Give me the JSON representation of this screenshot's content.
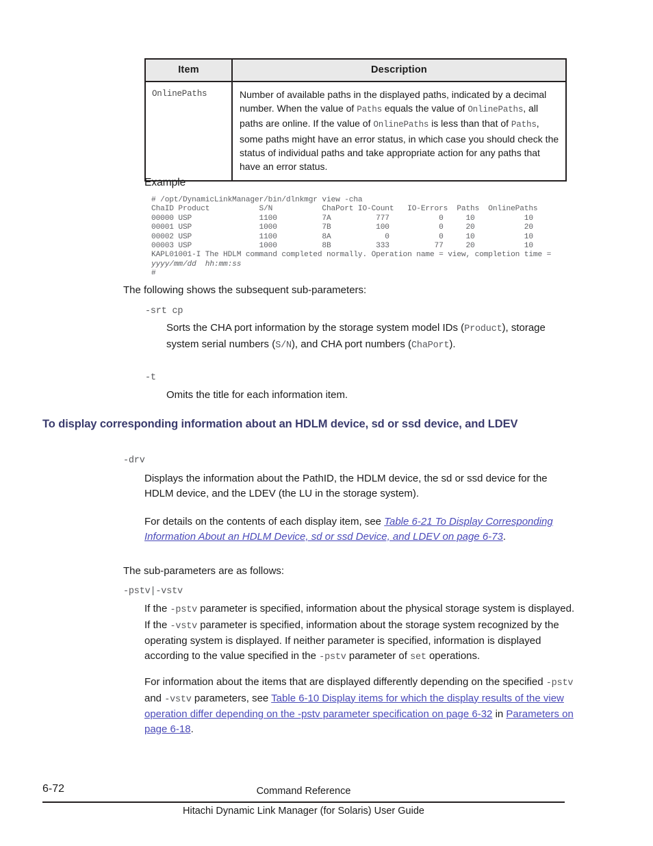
{
  "table": {
    "headers": [
      "Item",
      "Description"
    ],
    "rows": [
      {
        "item": "OnlinePaths",
        "description_segments": [
          {
            "t": "Number of available paths in the displayed paths, indicated by a decimal number. When the value of ",
            "k": "text"
          },
          {
            "t": "Paths",
            "k": "code"
          },
          {
            "t": " equals the value of ",
            "k": "text"
          },
          {
            "t": "OnlinePaths",
            "k": "code"
          },
          {
            "t": ", all paths are online. If the value of ",
            "k": "text"
          },
          {
            "t": "OnlinePaths",
            "k": "code"
          },
          {
            "t": " is less than that of ",
            "k": "text"
          },
          {
            "t": "Paths",
            "k": "code"
          },
          {
            "t": ", some paths might have an error status, in which case you should check the status of individual paths and take appropriate action for any paths that have an error status.",
            "k": "text"
          }
        ]
      }
    ]
  },
  "example": {
    "label": "Example",
    "lines": [
      "# /opt/DynamicLinkManager/bin/dlnkmgr view -cha",
      "ChaID Product           S/N           ChaPort IO-Count   IO-Errors  Paths  OnlinePaths",
      "00000 USP               1100          7A          777           0     10           10",
      "00001 USP               1000          7B          100           0     20           20",
      "00002 USP               1100          8A            0           0     10           10",
      "00003 USP               1000          8B          333          77     20           10",
      "KAPL01001-I The HDLM command completed normally. Operation name = view, completion time ="
    ],
    "italic_line": "yyyy/mm/dd  hh:mm:ss",
    "prompt_line": "#"
  },
  "body": {
    "following_intro": "The following shows the subsequent sub-parameters:",
    "srt_term": "-srt cp",
    "srt_desc_segments": [
      {
        "t": "Sorts the CHA port information by the storage system model IDs (",
        "k": "text"
      },
      {
        "t": "Product",
        "k": "code"
      },
      {
        "t": "), storage system serial numbers (",
        "k": "text"
      },
      {
        "t": "S/N",
        "k": "code"
      },
      {
        "t": "), and CHA port numbers (",
        "k": "text"
      },
      {
        "t": "ChaPort",
        "k": "code"
      },
      {
        "t": ").",
        "k": "text"
      }
    ],
    "t_term": "-t",
    "t_desc": "Omits the title for each information item.",
    "section_heading": "To display corresponding information about an HDLM device, sd or ssd device, and LDEV",
    "drv_term": "-drv",
    "drv_desc": "Displays the information about the PathID, the HDLM device, the sd or ssd device for the HDLM device, and the LDEV (the LU in the storage system).",
    "drv_desc2_segments": [
      {
        "t": "For details on the contents of each display item, see ",
        "k": "text"
      },
      {
        "t": "Table 6-21 To Display Corresponding Information About an HDLM Device, sd or ssd Device, and LDEV on page 6-73",
        "k": "link-italic"
      },
      {
        "t": ".",
        "k": "text"
      }
    ],
    "subparams_intro": "The sub-parameters are as follows:",
    "pstv_term": "-pstv|-vstv",
    "pstv_desc_segments": [
      {
        "t": "If the ",
        "k": "text"
      },
      {
        "t": "-pstv",
        "k": "code"
      },
      {
        "t": " parameter is specified, information about the physical storage system is displayed. If the ",
        "k": "text"
      },
      {
        "t": "-vstv",
        "k": "code"
      },
      {
        "t": " parameter is specified, information about the storage system recognized by the operating system is displayed. If neither parameter is specified, information is displayed according to the value specified in the ",
        "k": "text"
      },
      {
        "t": "-pstv",
        "k": "code"
      },
      {
        "t": " parameter of ",
        "k": "text"
      },
      {
        "t": "set",
        "k": "code"
      },
      {
        "t": " operations.",
        "k": "text"
      }
    ],
    "pstv_desc2_segments": [
      {
        "t": "For information about the items that are displayed differently depending on the specified ",
        "k": "text"
      },
      {
        "t": "-pstv",
        "k": "code"
      },
      {
        "t": " and ",
        "k": "text"
      },
      {
        "t": "-vstv",
        "k": "code"
      },
      {
        "t": " parameters, see ",
        "k": "text"
      },
      {
        "t": "Table 6-10 Display items for which the display results of the view operation differ depending on the -pstv parameter specification on page 6-32",
        "k": "link"
      },
      {
        "t": " in ",
        "k": "text"
      },
      {
        "t": "Parameters on page 6-18",
        "k": "link"
      },
      {
        "t": ".",
        "k": "text"
      }
    ]
  },
  "footer": {
    "page_number": "6-72",
    "chapter": "Command Reference",
    "guide_title": "Hitachi Dynamic Link Manager (for Solaris) User Guide"
  },
  "colors": {
    "heading": "#3a3b6d",
    "link": "#4a4ab9",
    "code": "#55565a",
    "table_header_bg": "#e9e9e9",
    "border": "#231f20"
  }
}
